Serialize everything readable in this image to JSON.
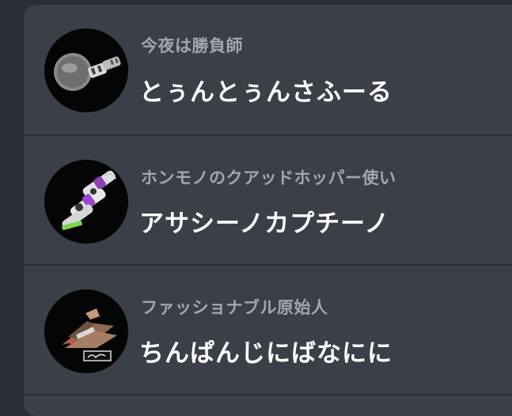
{
  "entries": [
    {
      "subtitle": "今夜は勝負師",
      "name": "とぅんとぅんさふーる",
      "avatar_icon": "frying-pan-weapon-icon"
    },
    {
      "subtitle": "ホンモノのクアッドホッパー使い",
      "name": "アサシーノカプチーノ",
      "avatar_icon": "quad-hopper-weapon-icon"
    },
    {
      "subtitle": "ファッショナブル原始人",
      "name": "ちんぱんじにばなにに",
      "avatar_icon": "tri-stringer-weapon-icon"
    }
  ],
  "colors": {
    "background": "#2a2d34",
    "panel": "#3b3f47",
    "subtitle": "#a4a6ab",
    "title": "#ffffff",
    "avatar_bg": "#050506"
  }
}
